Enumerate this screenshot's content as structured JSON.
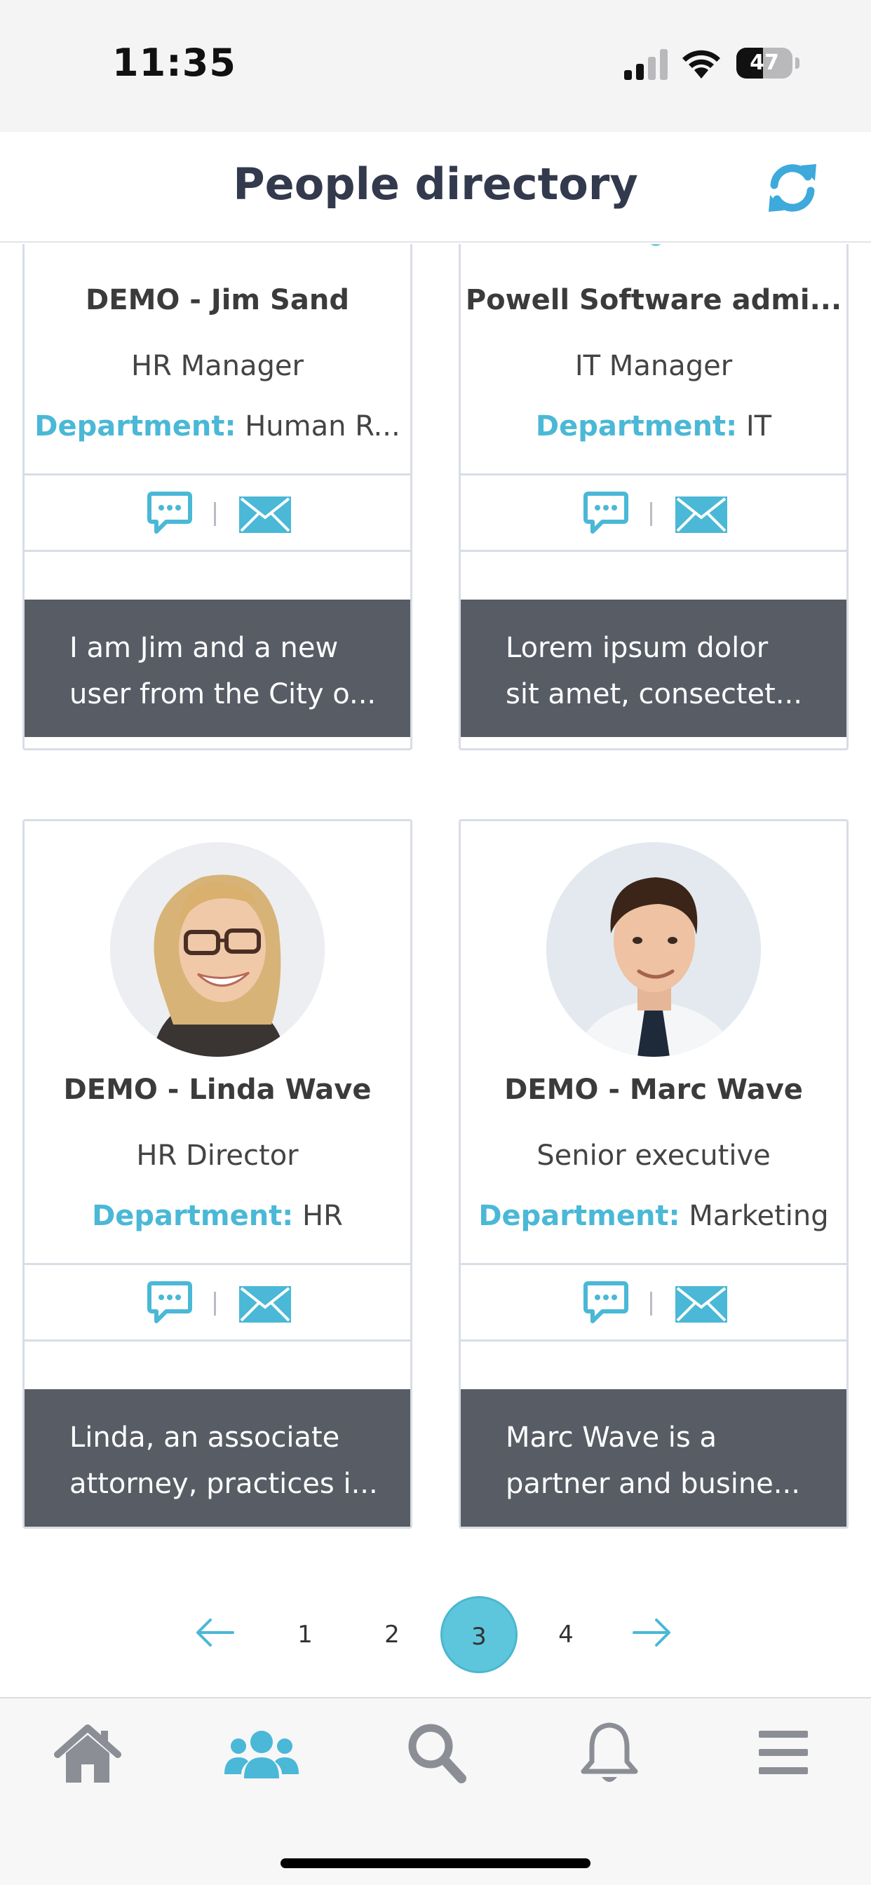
{
  "status_bar": {
    "time": "11:35",
    "battery": "47",
    "icons": [
      "signal-icon",
      "wifi-icon",
      "battery-icon"
    ]
  },
  "header": {
    "title": "People directory",
    "refresh_icon": "refresh-icon"
  },
  "people": [
    {
      "name": "DEMO - Jim Sand",
      "role": "HR Manager",
      "department_label": "Department:",
      "department": "Human R...",
      "bio_line1": "I am Jim and a new",
      "bio_line2": "user from the City o..."
    },
    {
      "name": "Powell Software admi...",
      "role": "IT Manager",
      "department_label": "Department:",
      "department": "IT",
      "bio_line1": "Lorem ipsum dolor",
      "bio_line2": "sit amet, consectet..."
    },
    {
      "name": "DEMO - Linda Wave",
      "role": "HR Director",
      "department_label": "Department:",
      "department": "HR",
      "bio_line1": "Linda, an associate",
      "bio_line2": "attorney, practices i..."
    },
    {
      "name": "DEMO - Marc Wave",
      "role": "Senior executive",
      "department_label": "Department:",
      "department": "Marketing",
      "bio_line1": "Marc Wave is a",
      "bio_line2": "partner and busine..."
    }
  ],
  "pagination": {
    "prev_icon": "arrow-left-icon",
    "next_icon": "arrow-right-icon",
    "pages": [
      "1",
      "2",
      "3",
      "4"
    ],
    "current": "3"
  },
  "bottom_nav": {
    "items": [
      "home-icon",
      "people-icon",
      "search-icon",
      "bell-icon",
      "menu-icon"
    ],
    "active": "people-icon"
  },
  "colors": {
    "accent": "#4ab8d6",
    "title": "#333a4d",
    "bio_bg": "#575c65",
    "card_border": "#d8dde6"
  }
}
